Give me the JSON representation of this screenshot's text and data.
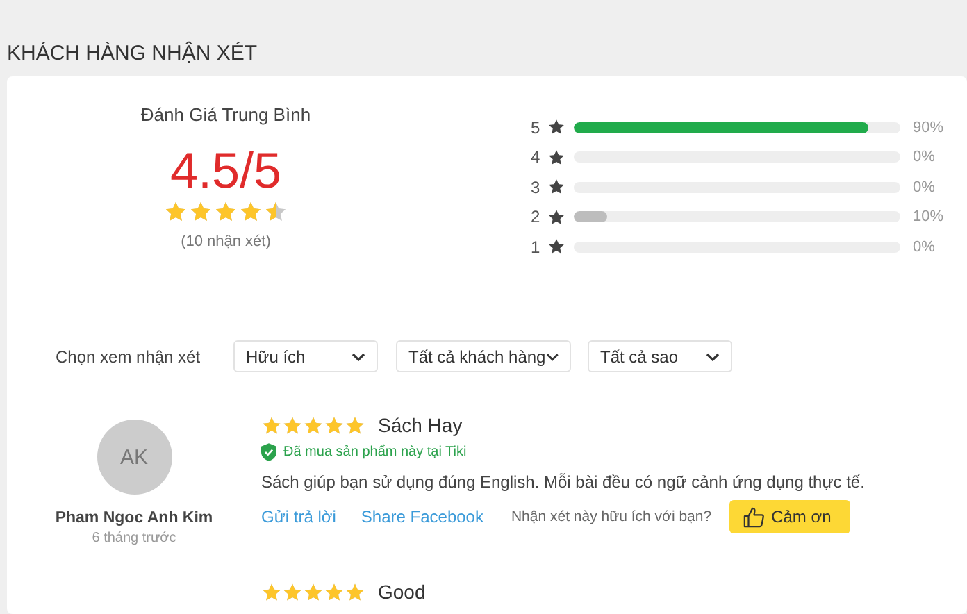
{
  "section_title": "KHÁCH HÀNG NHẬN XÉT",
  "summary": {
    "heading": "Đánh Giá Trung Bình",
    "score": "4.5/5",
    "stars": 4.5,
    "count": "(10 nhận xét)"
  },
  "histogram": [
    {
      "label": "5",
      "level": 0.9,
      "percent": "90%"
    },
    {
      "label": "4",
      "percent": "0%"
    },
    {
      "label": "3",
      "percent": "0%"
    },
    {
      "label": "2",
      "level": 0.1,
      "percent": "10%"
    },
    {
      "label": "1",
      "percent": "0%"
    }
  ],
  "filter": {
    "label": "Chọn xem nhận xét",
    "selects": [
      {
        "value": "Hữu ích"
      },
      {
        "value": "Tất cả khách hàng"
      },
      {
        "value": "Tất cả sao"
      }
    ]
  },
  "reviews": [
    {
      "initials": "AK",
      "name": "Pham Ngoc Anh Kim",
      "time": "6 tháng trước",
      "stars": 5,
      "title": "Sách Hay",
      "verified": "Đã mua sản phẩm này tại Tiki",
      "body": "Sách giúp bạn sử dụng đúng English. Mỗi bài đều có ngữ cảnh ứng dụng thực tế.",
      "reply": "Gửi trả lời",
      "share": "Share Facebook",
      "helpful_question": "Nhận xét này hữu ích với bạn?",
      "thanks": "Cảm ơn"
    },
    {
      "stars": 5,
      "title": "Good"
    }
  ]
}
